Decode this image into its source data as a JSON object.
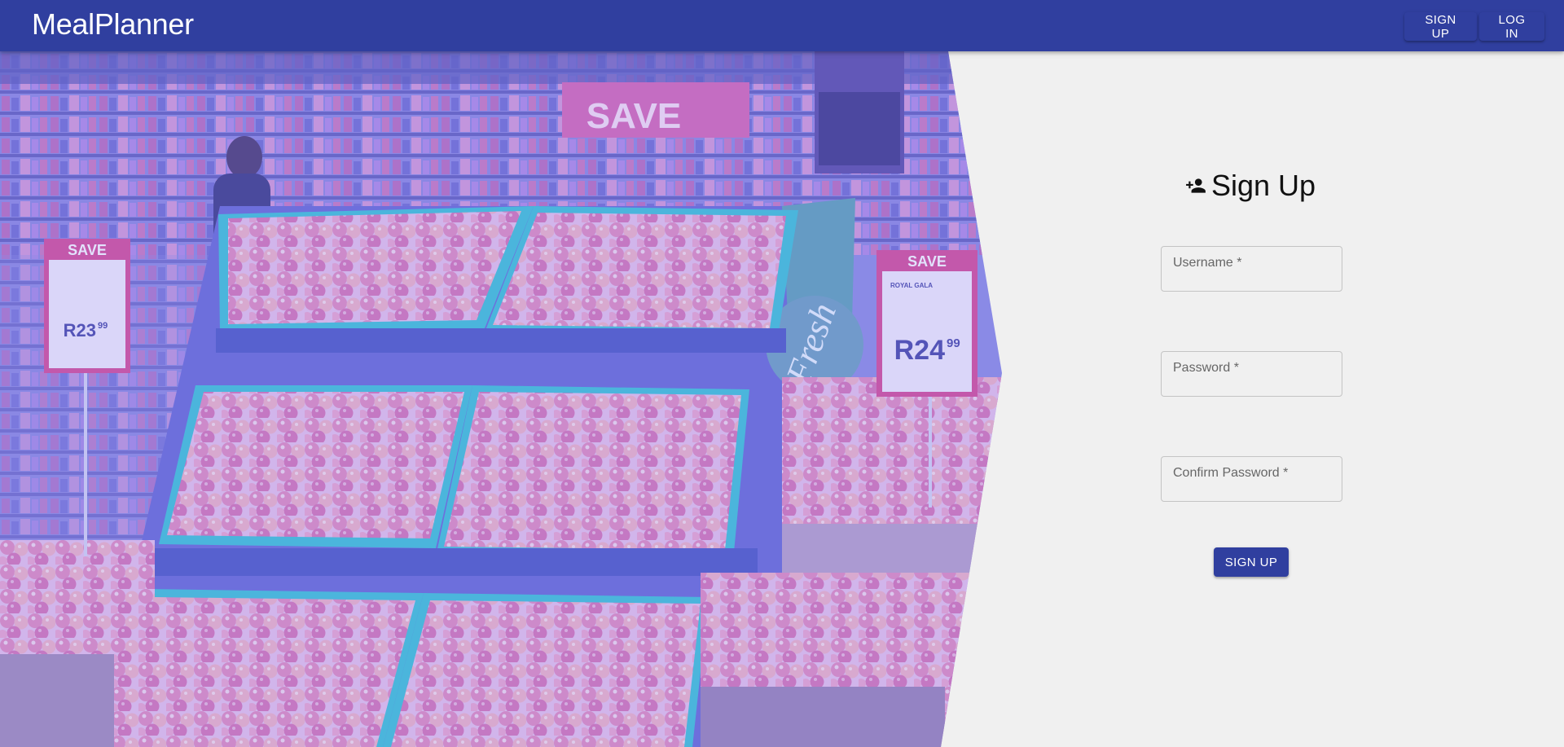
{
  "app": {
    "title": "MealPlanner"
  },
  "nav": {
    "signup_label": "SIGN UP",
    "login_label": "LOG IN"
  },
  "form": {
    "title": "Sign Up",
    "icon": "person-add-icon",
    "fields": [
      {
        "label": "Username *",
        "value": ""
      },
      {
        "label": "Password *",
        "value": ""
      },
      {
        "label": "Confirm Password *",
        "value": ""
      }
    ],
    "submit_label": "SIGN UP"
  },
  "hero": {
    "sign_left": {
      "title": "SAVE",
      "price": "R23",
      "cents": "99"
    },
    "sign_right": {
      "title": "SAVE",
      "product": "ROYAL GALA",
      "price": "R24",
      "cents": "99"
    },
    "banner": "SAVE",
    "display_logo": "Fresh"
  },
  "colors": {
    "primary": "#303f9f",
    "background": "#f0f0f0",
    "tint": "#7a7af0"
  }
}
